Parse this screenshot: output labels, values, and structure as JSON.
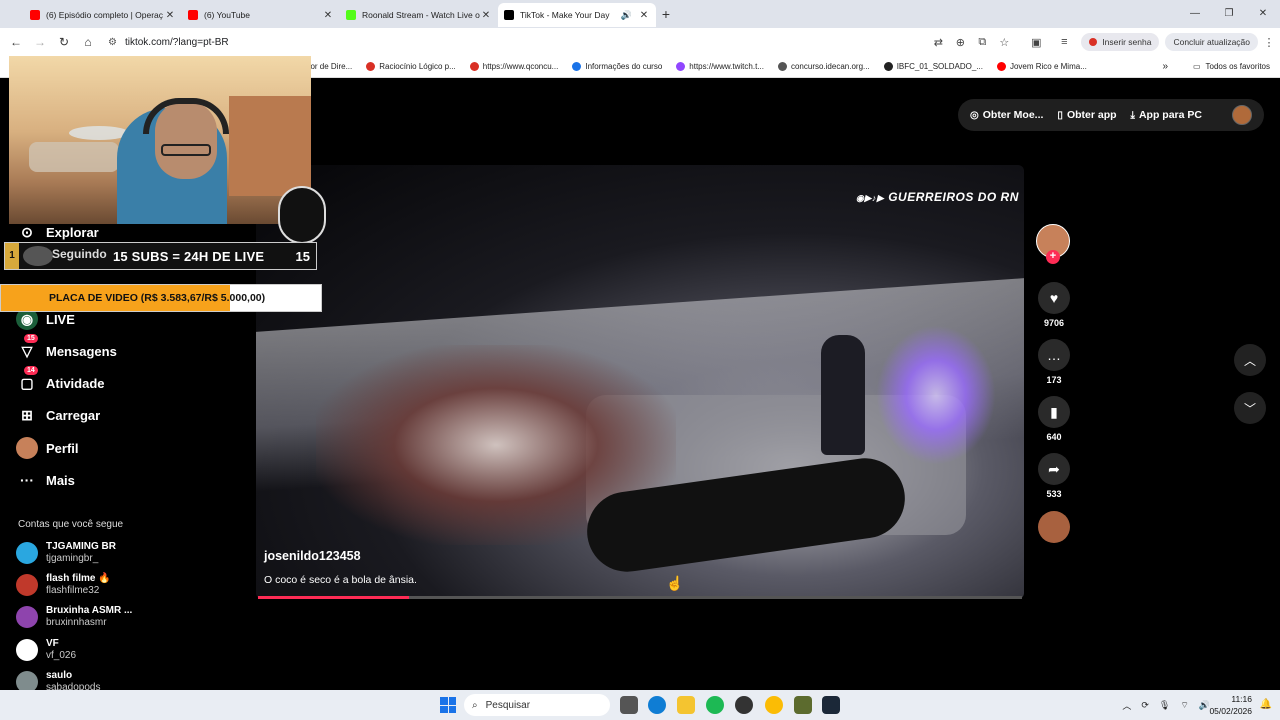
{
  "browser": {
    "tabs": [
      {
        "title": "(6) Episódio completo | Operaç",
        "favicon_color": "#ff0000"
      },
      {
        "title": "(6) YouTube",
        "favicon_color": "#ff0000"
      },
      {
        "title": "Roonald Stream - Watch Live o",
        "favicon_color": "#53fc18"
      },
      {
        "title": "TikTok - Make Your Day",
        "favicon_color": "#000000",
        "active": true
      }
    ],
    "url": "tiktok.com/?lang=pt-BR",
    "signin_label": "Inserir senha",
    "update_label": "Concluir atualização",
    "bookmarks": [
      {
        "label": "dor de Dire...",
        "color": "#888888"
      },
      {
        "label": "Raciocínio Lógico p...",
        "color": "#d93025"
      },
      {
        "label": "https://www.qconcu...",
        "color": "#d93025"
      },
      {
        "label": "Informações do curso",
        "color": "#1a73e8"
      },
      {
        "label": "https://www.twitch.t...",
        "color": "#9146ff"
      },
      {
        "label": "concurso.idecan.org...",
        "color": "#555555"
      },
      {
        "label": "IBFC_01_SOLDADO_...",
        "color": "#222222"
      },
      {
        "label": "Jovem Rico e Mima...",
        "color": "#ff0000"
      }
    ],
    "all_bookmarks_label": "Todos os favoritos"
  },
  "sidebar": {
    "items": [
      {
        "label": "LIVE",
        "icon": "live-icon"
      },
      {
        "label": "Mensagens",
        "icon": "messages-icon",
        "badge": "15"
      },
      {
        "label": "Atividade",
        "icon": "activity-icon",
        "badge": "14"
      },
      {
        "label": "Carregar",
        "icon": "upload-icon"
      },
      {
        "label": "Perfil",
        "icon": "profile-icon"
      },
      {
        "label": "Mais",
        "icon": "more-icon"
      }
    ],
    "partial_items": [
      "Explorar",
      "Seguindo"
    ],
    "following_header": "Contas que você segue",
    "following": [
      {
        "name": "TJGAMING BR",
        "handle": "tjgamingbr_",
        "color": "#2aa7e0"
      },
      {
        "name": "flash filme 🔥",
        "handle": "flashfilme32",
        "color": "#c0392b"
      },
      {
        "name": "Bruxinha ASMR ...",
        "handle": "bruxinnhasmr",
        "color": "#8e44ad"
      },
      {
        "name": "VF",
        "handle": "vf_026",
        "color": "#ffffff"
      },
      {
        "name": "saulo",
        "handle": "sabadopods",
        "color": "#7f8c8d"
      }
    ]
  },
  "topbar": {
    "coins_label": "Obter Moe...",
    "app_label": "Obter app",
    "pc_label": "App para PC"
  },
  "video": {
    "watermark": "GUERREIROS DO RN",
    "username": "josenildo123458",
    "caption": "O coco é seco é a bola de ânsia.",
    "progress": 0.197
  },
  "actions": {
    "likes": "9706",
    "comments": "173",
    "saves": "640",
    "shares": "533"
  },
  "overlay": {
    "subs_text": "15 SUBS = 24H DE LIVE",
    "subs_count": "15",
    "subs_lead": "1",
    "placa_text": "PLACA DE VIDEO (R$ 3.583,67/R$ 5.000,00)",
    "placa_progress": 0.717
  },
  "taskbar": {
    "search_placeholder": "Pesquisar",
    "time": "11:16",
    "date": "05/02/2026"
  }
}
